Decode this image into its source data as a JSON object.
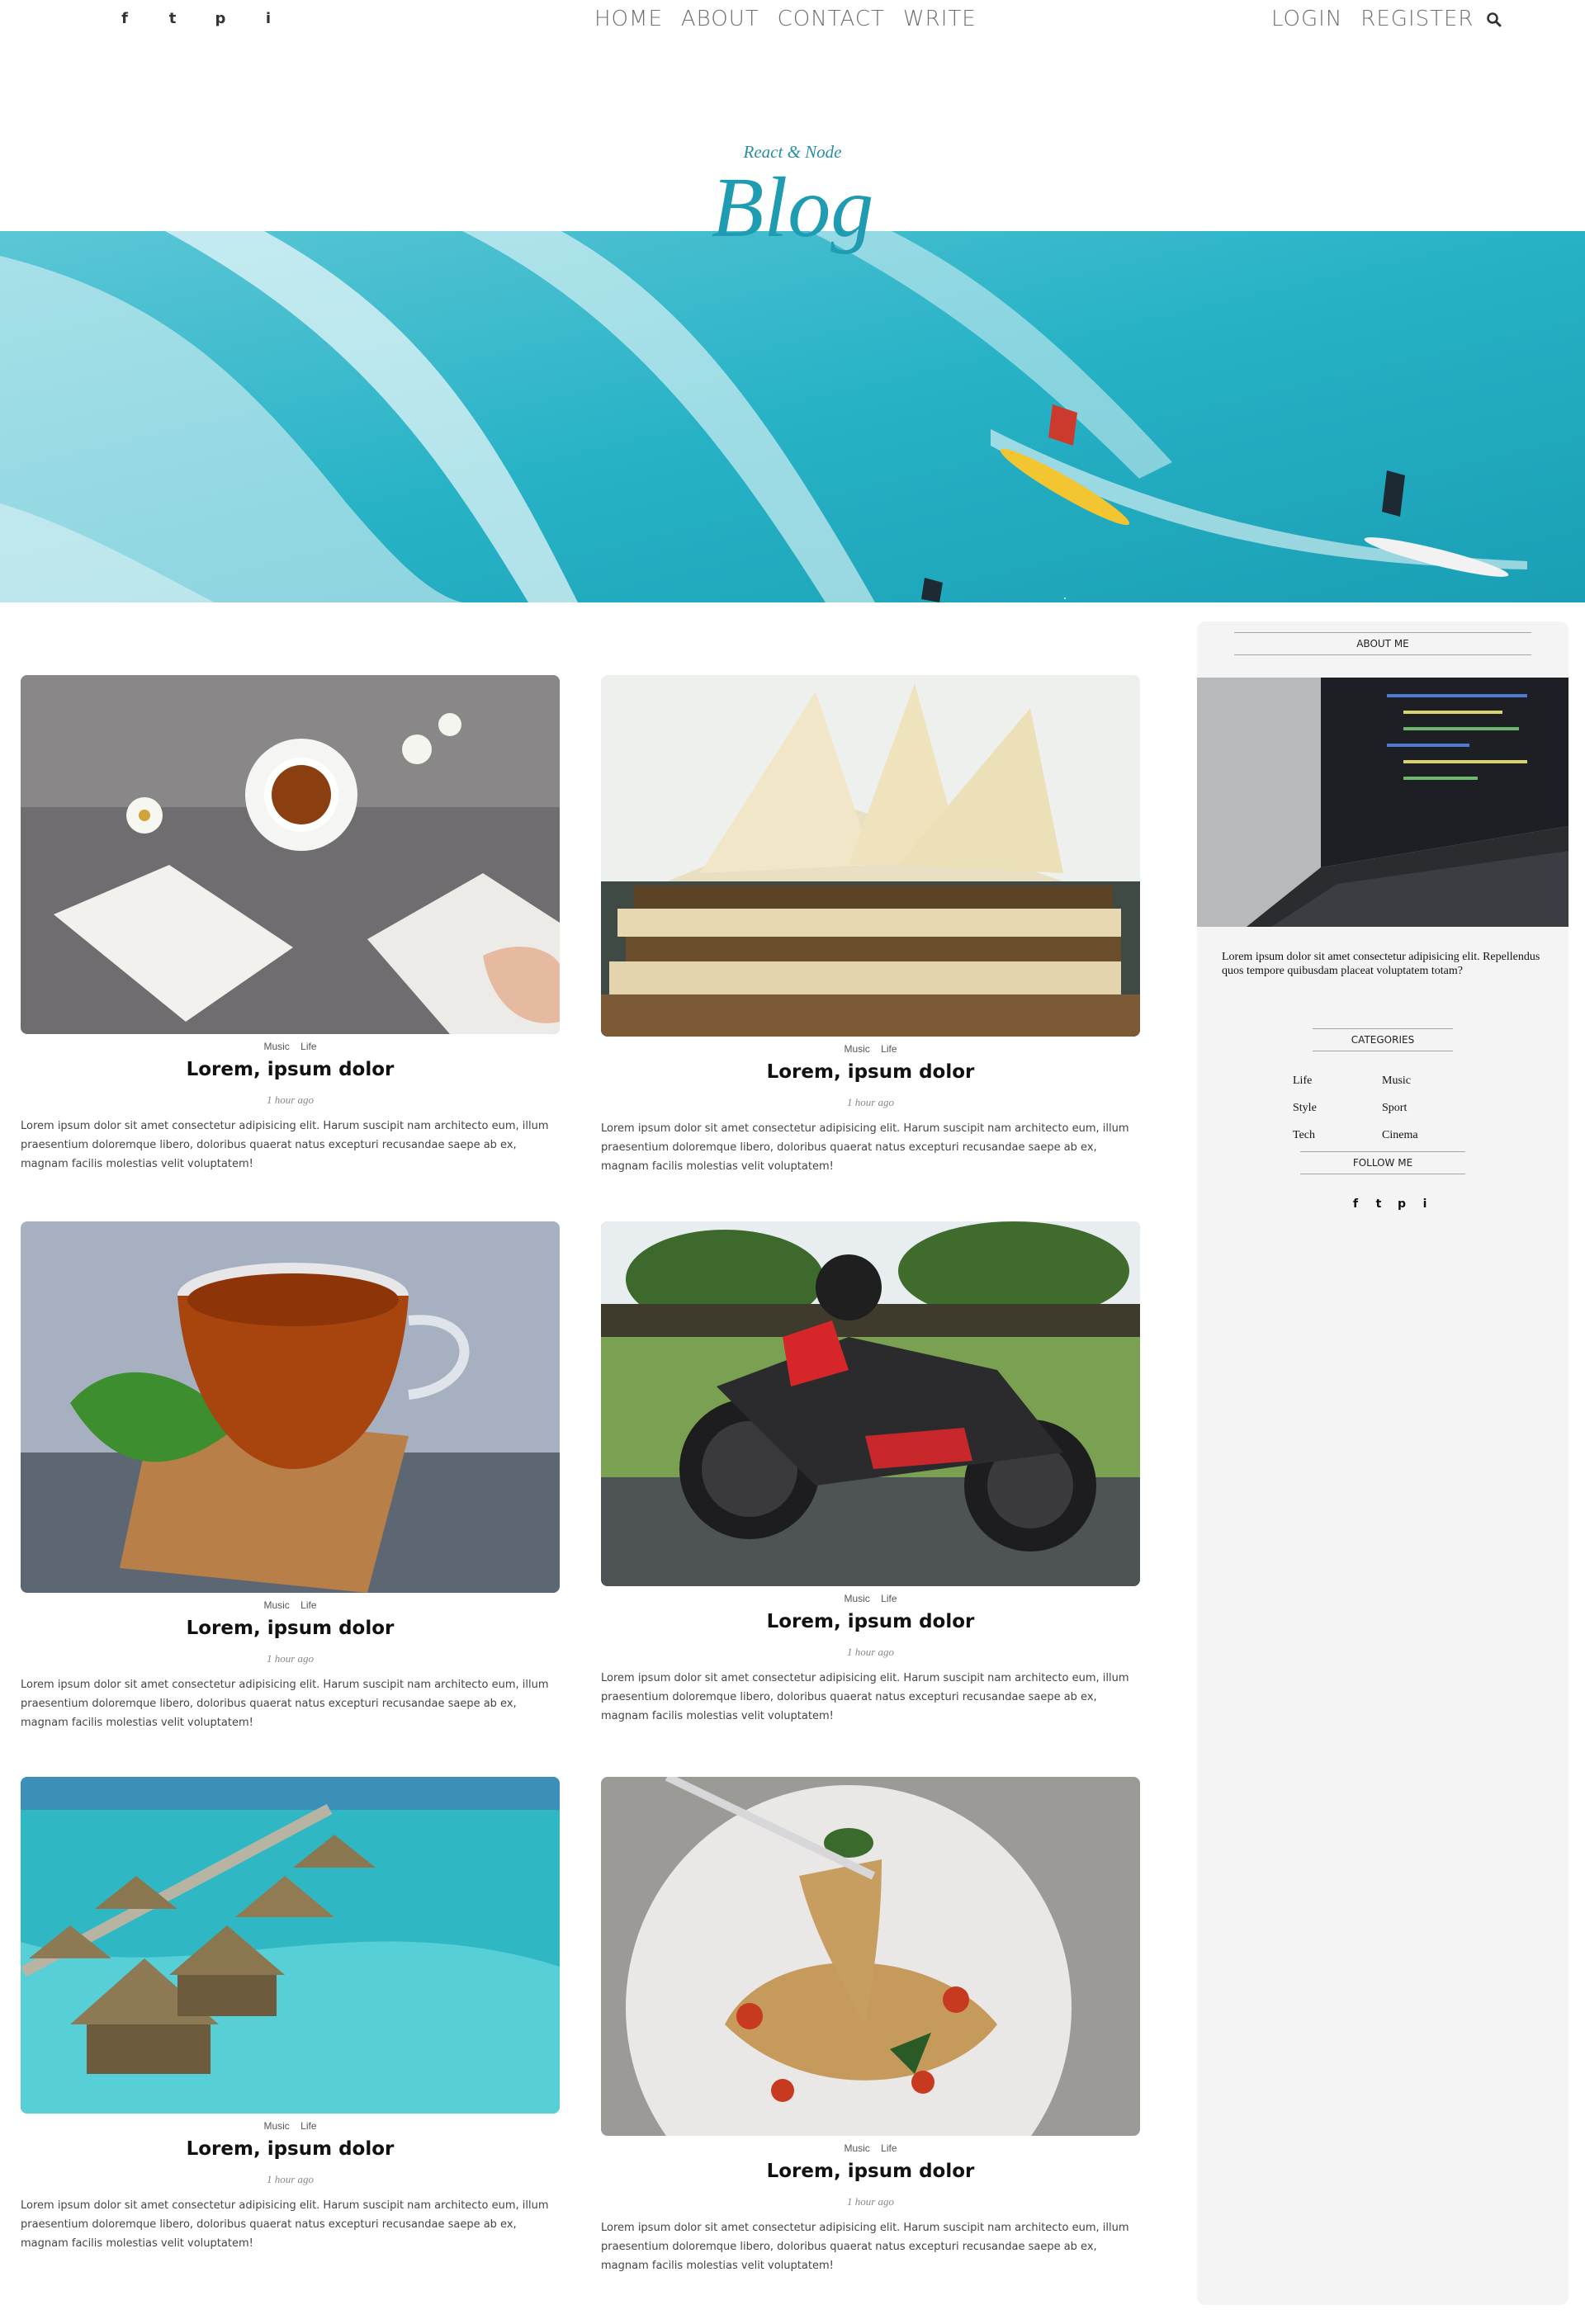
{
  "nav": {
    "social": [
      "f",
      "t",
      "p",
      "i"
    ],
    "social_icons": [
      "facebook-icon",
      "twitter-icon",
      "pinterest-icon",
      "instagram-icon"
    ],
    "links": [
      "HOME",
      "ABOUT",
      "CONTACT",
      "WRITE"
    ],
    "auth": [
      "LOGIN",
      "REGISTER"
    ],
    "search_icon": "search-icon"
  },
  "header": {
    "subtitle": "React & Node",
    "title": "Blog",
    "accent_color": "#1f9bb2"
  },
  "posts": [
    {
      "cats": [
        "Music",
        "Life"
      ],
      "title": "Lorem, ipsum dolor",
      "date": "1 hour ago",
      "desc": "Lorem ipsum dolor sit amet consectetur adipisicing elit. Harum suscipit nam architecto eum, illum praesentium doloremque libero, doloribus quaerat natus excepturi recusandae saepe ab ex, magnam facilis molestias velit voluptatem!"
    },
    {
      "cats": [
        "Music",
        "Life"
      ],
      "title": "Lorem, ipsum dolor",
      "date": "1 hour ago",
      "desc": "Lorem ipsum dolor sit amet consectetur adipisicing elit. Harum suscipit nam architecto eum, illum praesentium doloremque libero, doloribus quaerat natus excepturi recusandae saepe ab ex, magnam facilis molestias velit voluptatem!"
    },
    {
      "cats": [
        "Music",
        "Life"
      ],
      "title": "Lorem, ipsum dolor",
      "date": "1 hour ago",
      "desc": "Lorem ipsum dolor sit amet consectetur adipisicing elit. Harum suscipit nam architecto eum, illum praesentium doloremque libero, doloribus quaerat natus excepturi recusandae saepe ab ex, magnam facilis molestias velit voluptatem!"
    },
    {
      "cats": [
        "Music",
        "Life"
      ],
      "title": "Lorem, ipsum dolor",
      "date": "1 hour ago",
      "desc": "Lorem ipsum dolor sit amet consectetur adipisicing elit. Harum suscipit nam architecto eum, illum praesentium doloremque libero, doloribus quaerat natus excepturi recusandae saepe ab ex, magnam facilis molestias velit voluptatem!"
    },
    {
      "cats": [
        "Music",
        "Life"
      ],
      "title": "Lorem, ipsum dolor",
      "date": "1 hour ago",
      "desc": "Lorem ipsum dolor sit amet consectetur adipisicing elit. Harum suscipit nam architecto eum, illum praesentium doloremque libero, doloribus quaerat natus excepturi recusandae saepe ab ex, magnam facilis molestias velit voluptatem!"
    },
    {
      "cats": [
        "Music",
        "Life"
      ],
      "title": "Lorem, ipsum dolor",
      "date": "1 hour ago",
      "desc": "Lorem ipsum dolor sit amet consectetur adipisicing elit. Harum suscipit nam architecto eum, illum praesentium doloremque libero, doloribus quaerat natus excepturi recusandae saepe ab ex, magnam facilis molestias velit voluptatem!"
    }
  ],
  "sidebar": {
    "about_title": "ABOUT ME",
    "about_text": "Lorem ipsum dolor sit amet consectetur adipisicing elit. Repellendus quos tempore quibusdam placeat voluptatem totam?",
    "categories_title": "CATEGORIES",
    "categories": [
      "Life",
      "Music",
      "Style",
      "Sport",
      "Tech",
      "Cinema"
    ],
    "follow_title": "FOLLOW ME",
    "follow": [
      "f",
      "t",
      "p",
      "i"
    ]
  }
}
